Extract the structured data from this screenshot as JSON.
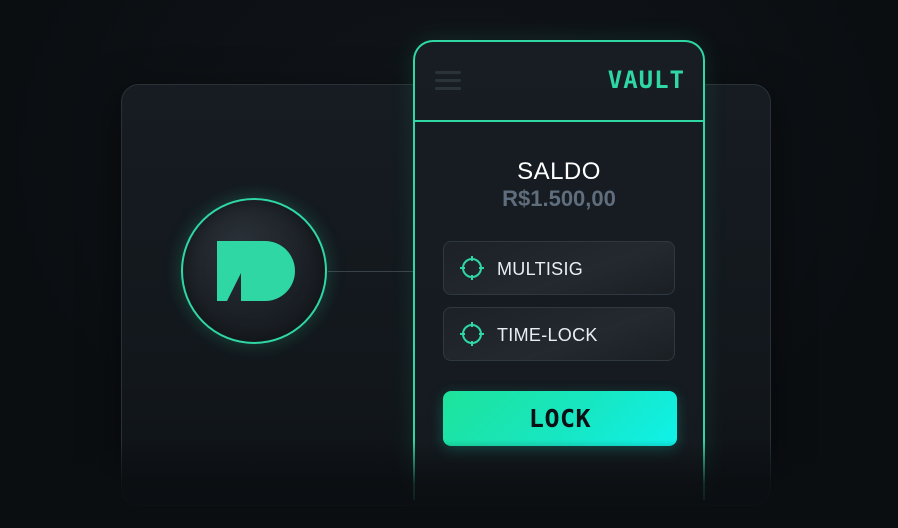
{
  "app": {
    "title": "VAULT"
  },
  "balance": {
    "label": "SALDO",
    "value": "R$1.500,00"
  },
  "options": [
    {
      "label": "MULTISIG",
      "icon": "crosshair-icon"
    },
    {
      "label": "TIME-LOCK",
      "icon": "crosshair-icon"
    }
  ],
  "actions": {
    "lock_label": "LOCK"
  },
  "colors": {
    "accent": "#2fd7a5",
    "accent_bright": "#0ff2ea",
    "background": "#0b0e11",
    "panel": "#161c22",
    "muted_text": "#5f6d7c"
  },
  "icons": {
    "logo": "brand-logo-icon",
    "menu": "hamburger-menu-icon"
  }
}
